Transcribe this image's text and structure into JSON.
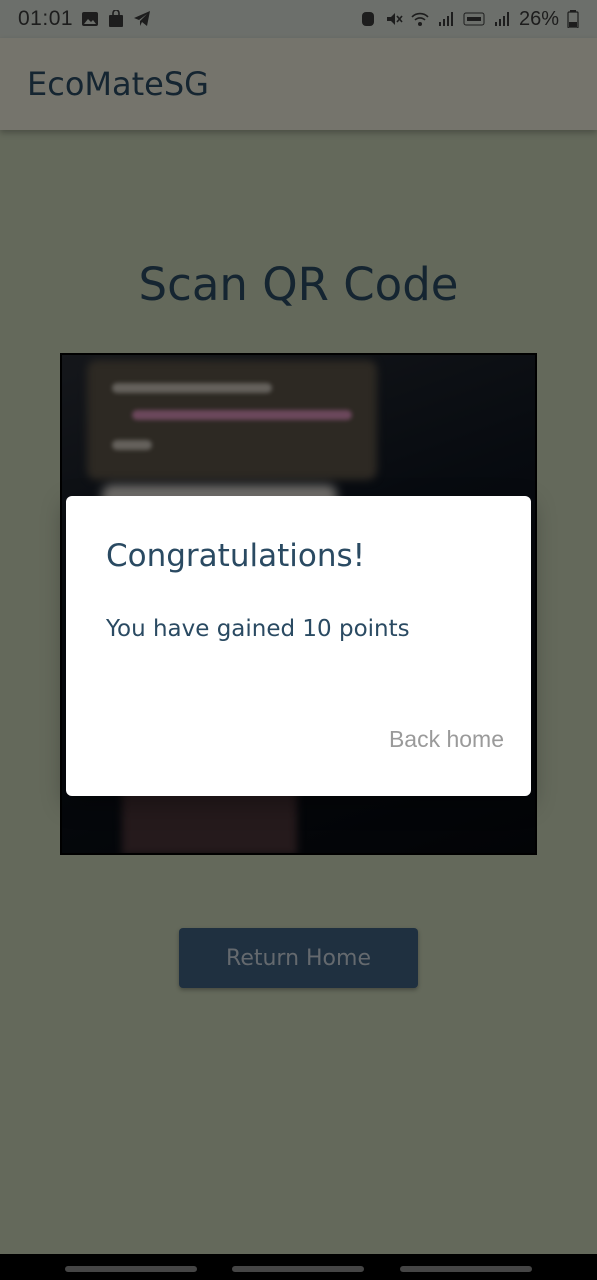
{
  "status_bar": {
    "time": "01:01",
    "battery": "26%",
    "left_icons": [
      "image-icon",
      "shopping-bag-icon",
      "telegram-icon"
    ],
    "right_icons": [
      "alarm-icon",
      "mute-icon",
      "wifi-icon",
      "signal-icon",
      "volte-lte2-icon",
      "signal-icon-2",
      "battery-icon"
    ]
  },
  "app_bar": {
    "title": "EcoMateSG"
  },
  "main": {
    "heading": "Scan QR Code",
    "return_button": "Return Home"
  },
  "dialog": {
    "title": "Congratulations!",
    "message": "You have gained 10 points",
    "action": "Back home"
  },
  "colors": {
    "primary_text": "#2a4a62",
    "button_bg": "#3e6080",
    "dialog_action": "#9a9a9a"
  }
}
